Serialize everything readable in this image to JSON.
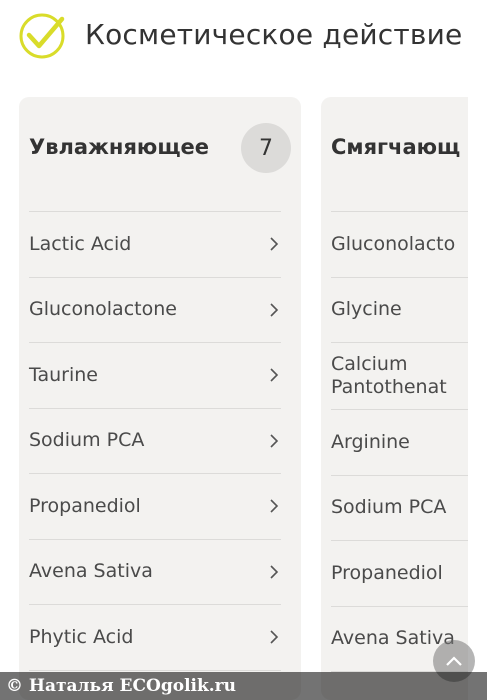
{
  "header": {
    "title": "Косметическое действие",
    "icon": "check-circle-icon",
    "accent_color": "#d9dc2a"
  },
  "cards": [
    {
      "title": "Увлажняющее",
      "count": "7",
      "items": [
        {
          "label": "Lactic Acid"
        },
        {
          "label": "Gluconolactone"
        },
        {
          "label": "Taurine"
        },
        {
          "label": "Sodium PCA"
        },
        {
          "label": "Propanediol"
        },
        {
          "label": "Avena Sativa"
        },
        {
          "label": "Phytic Acid"
        }
      ]
    },
    {
      "title": "Смягчающ",
      "items": [
        {
          "label": "Gluconolacto"
        },
        {
          "label": "Glycine"
        },
        {
          "label": "Calcium\nPantothenat"
        },
        {
          "label": "Arginine"
        },
        {
          "label": "Sodium PCA"
        },
        {
          "label": "Propanediol"
        },
        {
          "label": "Avena Sativa"
        }
      ]
    }
  ],
  "scroll_top": {
    "icon": "chevron-up-icon"
  },
  "watermark": {
    "text": "© Наталья ECOgolik.ru"
  }
}
